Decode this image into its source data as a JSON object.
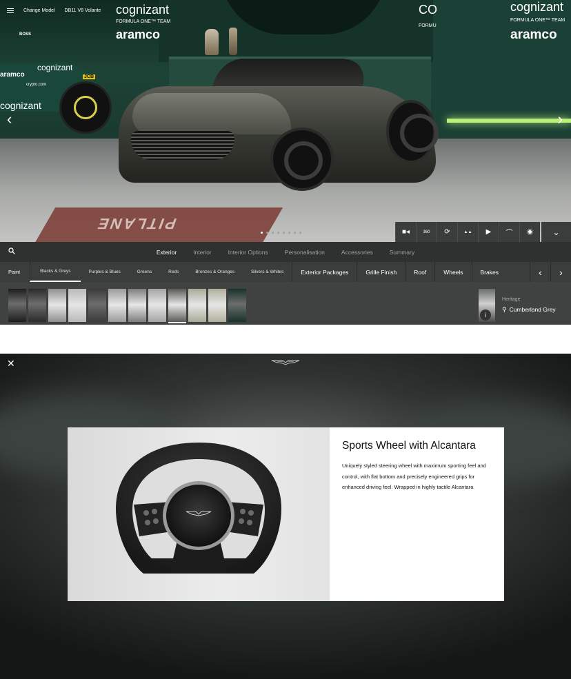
{
  "topbar": {
    "menu_icon": "hamburger-icon",
    "change_model": "Change Model",
    "model": "DB11 V8 Volante"
  },
  "scene": {
    "sponsors": {
      "cognizant_left": "cognizant",
      "formula_left": "FORMULA ONE™ TEAM",
      "aramco_left": "aramco",
      "cognizant_right": "cognizant",
      "formula_right": "FORMULA ONE™ TEAM",
      "aramco_right": "aramco",
      "cognizant_mid": "CO",
      "formula_mid": "FORMU",
      "car_brand": "cognizant",
      "car_brand2": "cognizant",
      "aramco_car": "aramco",
      "crypto": "crypto.com",
      "jcb": "JCB",
      "boss": "BOSS",
      "lane": "PITLANE"
    },
    "carousel_dots": 8,
    "active_dot": 0
  },
  "toolbar": {
    "buttons": [
      "camera-icon",
      "360-icon",
      "rotate-icon",
      "landscape-icon",
      "play-icon",
      "car-side-icon",
      "photo-icon"
    ],
    "glyphs": [
      "■◂",
      "360",
      "⟳",
      "▲▲",
      "▶",
      "⌒",
      "◉"
    ],
    "expand_icon": "chevron-down-icon"
  },
  "tabs": {
    "search_icon": "search-icon",
    "items": [
      "Exterior",
      "Interior",
      "Interior Options",
      "Personalisation",
      "Accessories",
      "Summary"
    ],
    "active": 0
  },
  "subnav": {
    "paint": "Paint",
    "filters": [
      "Blacks & Greys",
      "Purples & Blues",
      "Greens",
      "Reds",
      "Bronzes & Oranges",
      "Silvers & Whites"
    ],
    "selected_filter": 0,
    "categories": [
      "Exterior Packages",
      "Grille Finish",
      "Roof",
      "Wheels",
      "Brakes"
    ]
  },
  "swatches": {
    "colors": [
      "#1c1d1c",
      "#2a2b2a",
      "#8f918f",
      "#b8b9b8",
      "#3a3b3a",
      "#9a9b9a",
      "#7d7e7d",
      "#a4a5a4",
      "#5a5b55",
      "#a9ab99",
      "#b0b09e",
      "#18332c"
    ],
    "selected": 8
  },
  "heritage": {
    "label": "Heritage",
    "name": "Cumberland Grey",
    "info_icon": "info-icon",
    "search_icon": "magnifier-icon"
  },
  "modal": {
    "close_icon": "close-icon",
    "logo": "aston-martin-wings-logo",
    "title": "Sports Wheel with Alcantara",
    "description": "Uniquely styled steering wheel with maximum sporting feel and control, with flat bottom and precisely engineered grips for enhanced driving feel. Wrapped in highly tactile Alcantara"
  }
}
